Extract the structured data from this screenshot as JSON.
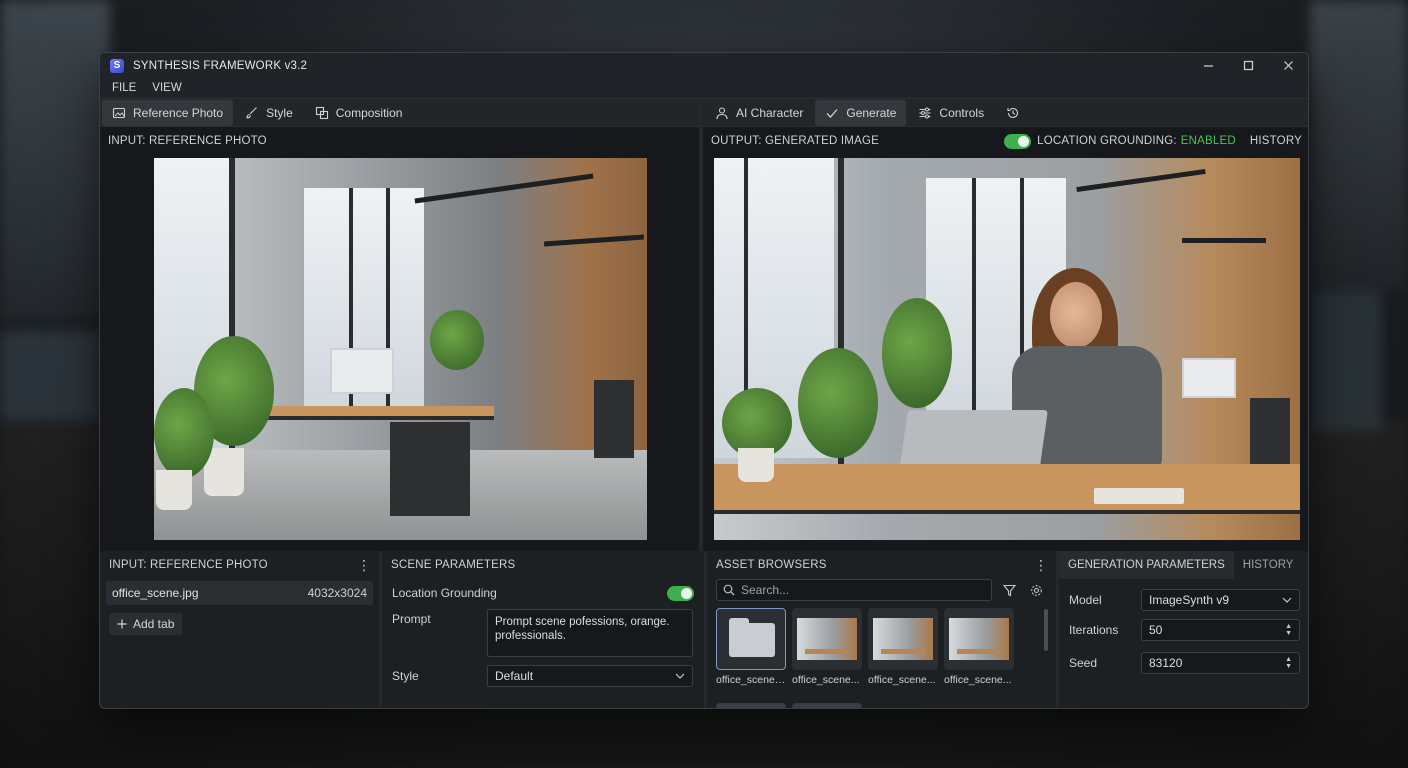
{
  "window": {
    "title": "SYNTHESIS FRAMEWORK v3.2",
    "logo_letter": "S"
  },
  "menu": [
    "FILE",
    "VIEW"
  ],
  "left_tabs": [
    {
      "label": "Reference Photo",
      "icon": "image-icon"
    },
    {
      "label": "Style",
      "icon": "brush-icon"
    },
    {
      "label": "Composition",
      "icon": "composition-icon"
    }
  ],
  "right_tabs": [
    {
      "label": "AI Character",
      "icon": "person-icon"
    },
    {
      "label": "Generate",
      "icon": "check-icon"
    },
    {
      "label": "Controls",
      "icon": "sliders-icon"
    }
  ],
  "input_header": "INPUT: REFERENCE PHOTO",
  "output_header": "OUTPUT: GENERATED IMAGE",
  "grounding": {
    "label": "LOCATION GROUNDING:",
    "state": "ENABLED",
    "enabled": true,
    "color": "#4cc25b"
  },
  "history_label": "HISTORY",
  "ref_panel": {
    "title": "INPUT: REFERENCE PHOTO",
    "file": {
      "name": "office_scene.jpg",
      "dimensions": "4032x3024"
    },
    "add_tab": "Add tab"
  },
  "scene_params": {
    "title": "SCENE PARAMETERS",
    "grounding_label": "Location Grounding",
    "grounding_on": true,
    "prompt_label": "Prompt",
    "prompt_value": "Prompt scene pofessions, orange. professionals.",
    "style_label": "Style",
    "style_value": "Default"
  },
  "asset_browser": {
    "title": "ASSET BROWSERS",
    "search_placeholder": "Search...",
    "items": [
      "office_scene....",
      "office_scene...",
      "office_scene...",
      "office_scene..."
    ]
  },
  "gen_params": {
    "tab_active": "GENERATION PARAMETERS",
    "tab_other": "HISTORY",
    "model_label": "Model",
    "model_value": "ImageSynth v9",
    "iterations_label": "Iterations",
    "iterations_value": "50",
    "seed_label": "Seed",
    "seed_value": "83120"
  }
}
